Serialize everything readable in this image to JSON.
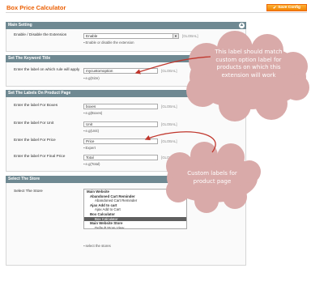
{
  "page": {
    "title": "Box Price Calculator",
    "save_button": "Save Config"
  },
  "sections": {
    "main_setting": {
      "title": "Main Setting",
      "enable_label": "Enable / Disable the Extension",
      "enable_value": "Enable",
      "enable_scope": "[GLOBAL]",
      "enable_note": "Enable or disable the extension"
    },
    "keyword_title": {
      "title": "Set The Keyword Title",
      "label": "Enter the label on which rule will apply",
      "value": "mycustomoption",
      "scope": "[GLOBAL]",
      "note": "e.g(Size)"
    },
    "labels": {
      "title": "Set The Labels On Product Page",
      "boxes_label": "Enter the label For Boxes",
      "boxes_value": "boxes",
      "boxes_scope": "[GLOBAL]",
      "boxes_note": "e.g(Boxes)",
      "unit_label": "Enter the label For Unit",
      "unit_value": "Unit",
      "unit_scope": "[GLOBAL]",
      "unit_note": "e.g(Unit)",
      "price_label": "Enter the label For Price",
      "price_value": "Price",
      "price_scope": "[GLOBAL]",
      "price_note": "Expert",
      "final_label": "Enter the label For Final Price",
      "final_value": "Total",
      "final_scope": "[GLOBAL]",
      "final_note": "e.g(Total)"
    },
    "store": {
      "title": "Select The Store",
      "label": "Select The Store",
      "note": "select the stores",
      "options": [
        {
          "text": "Main Website",
          "level": 0,
          "selected": false
        },
        {
          "text": "Abandoned Cart Reminder",
          "level": 1,
          "selected": false
        },
        {
          "text": "Abandoned Cart Reminder",
          "level": 2,
          "selected": false
        },
        {
          "text": "Ajax Add to cart",
          "level": 1,
          "selected": false
        },
        {
          "text": "Ajax Add to Cart",
          "level": 2,
          "selected": false
        },
        {
          "text": "Box Calculator",
          "level": 1,
          "selected": false
        },
        {
          "text": "Box Calculator",
          "level": 2,
          "selected": true
        },
        {
          "text": "Main Website Store",
          "level": 1,
          "selected": false
        },
        {
          "text": "Default Store View",
          "level": 2,
          "selected": false
        }
      ]
    }
  },
  "callouts": {
    "top": {
      "line1": "This label should match",
      "line2": "custom option label for",
      "line3": "products on which this",
      "line4": "extension will work"
    },
    "bottom": {
      "line1": "Custom labels for",
      "line2": "product page"
    }
  },
  "colors": {
    "title": "#eb5e00",
    "section_header": "#6f8992",
    "button": "#f18200",
    "callout": "#d9aaa9",
    "arrow": "#c0362c"
  }
}
